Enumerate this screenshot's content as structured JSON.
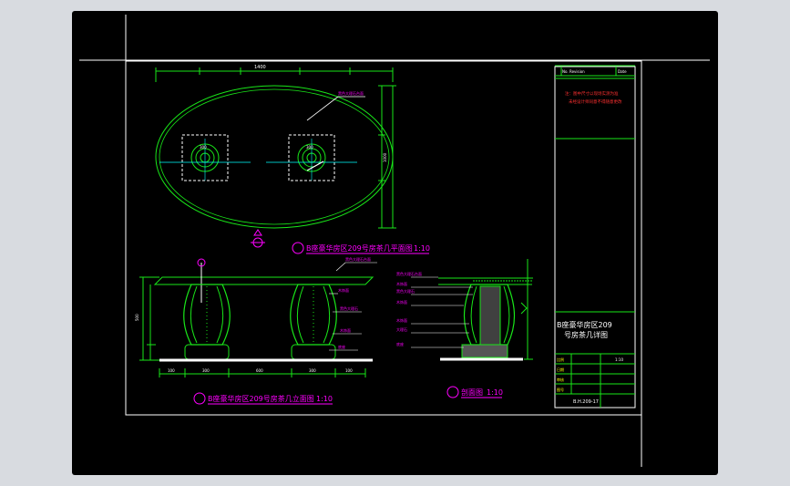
{
  "window": {
    "title": ""
  },
  "plan_view": {
    "title": "B座豪华房区209号房茶几平面图",
    "scale": "1:10",
    "overall_width_dim": "1400",
    "top_note": "黑色大理石台面",
    "square_dims": [
      "300",
      "300"
    ],
    "height_dim": "1000"
  },
  "front_elevation": {
    "title": "B座豪华房区209号房茶几立面图",
    "scale": "1:10",
    "height_dim": "500",
    "bottom_dims": [
      "100",
      "300",
      "600",
      "300",
      "100"
    ],
    "notes": [
      "黑色大理石台面",
      "木饰面",
      "黑色大理石",
      "木饰面",
      "底座"
    ]
  },
  "section_view": {
    "title": "剖面图",
    "scale": "1:10",
    "notes": [
      "黑色大理石台面",
      "木饰面",
      "黑色大理石",
      "木饰面",
      "木饰面",
      "大理石",
      "底座"
    ]
  },
  "title_block": {
    "header_cells": [
      "No.",
      "Revision",
      "Date"
    ],
    "remarks": [
      "注：图中尺寸以现场实测为准",
      "未经设计师同意不得随意更改"
    ],
    "drawing_name": "B座豪华房区209号房茶几详图",
    "rows": [
      {
        "label": "比例",
        "value": "1:10"
      },
      {
        "label": "日期",
        "value": ""
      },
      {
        "label": "审核",
        "value": ""
      },
      {
        "label": "图号",
        "value": ""
      }
    ],
    "drawing_number": "B.H.209-17"
  },
  "colors": {
    "background": "#000000",
    "line_green": "#19e619",
    "line_magenta": "#ff00ff",
    "line_white": "#ffffff",
    "text_yellow": "#ffff00",
    "text_red": "#ff3030",
    "text_cyan": "#00ffff"
  }
}
